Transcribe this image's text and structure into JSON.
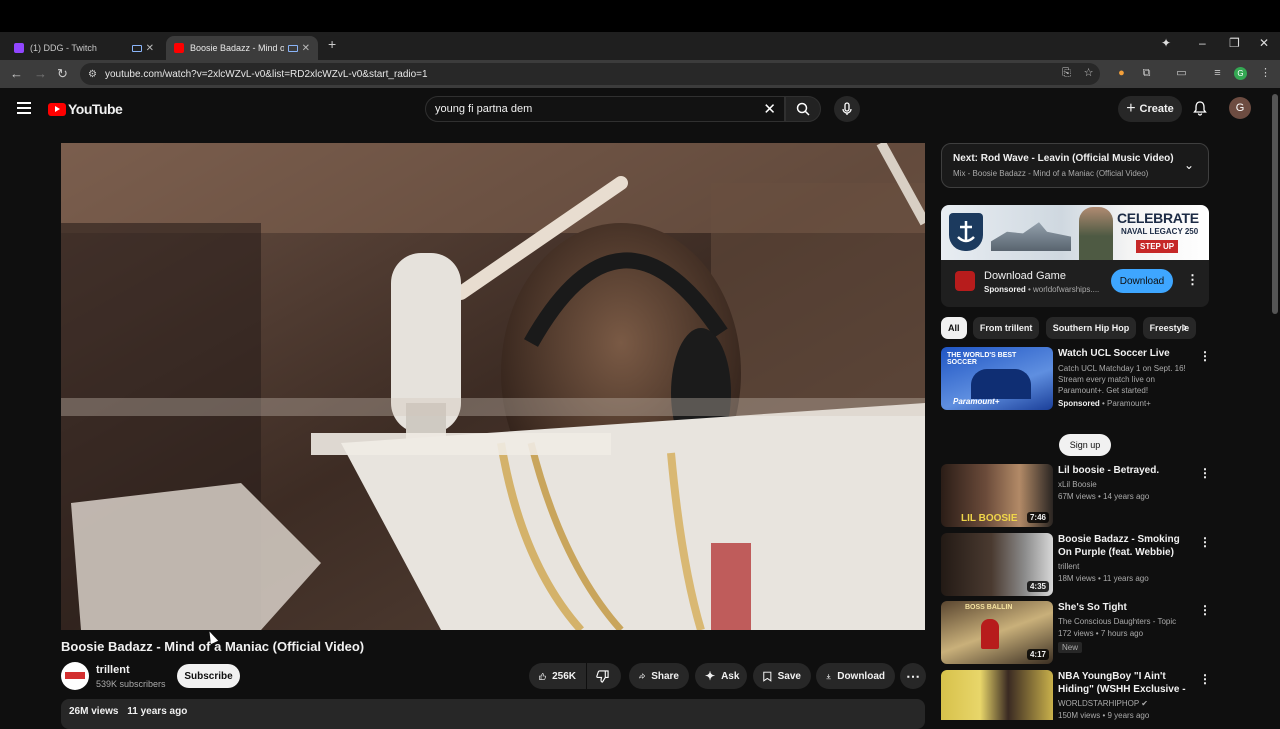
{
  "browser": {
    "tabs": [
      {
        "title": "(1) DDG - Twitch",
        "favicon_color": "#9146ff"
      },
      {
        "title": "Boosie Badazz - Mind of a Maniac (Official Video)",
        "favicon_color": "#ff0000"
      }
    ],
    "url": "youtube.com/watch?v=2xlcWZvL-v0&list=RD2xlcWZvL-v0&start_radio=1"
  },
  "masthead": {
    "logo_text": "YouTube",
    "search_value": "young fi partna dem",
    "create_label": "Create",
    "avatar_letter": "G"
  },
  "video": {
    "title": "Boosie Badazz - Mind of a Maniac (Official Video)",
    "channel": "trillent",
    "subscribers": "539K subscribers",
    "subscribe_label": "Subscribe",
    "likes": "256K",
    "share_label": "Share",
    "ask_label": "Ask",
    "save_label": "Save",
    "download_label": "Download",
    "views": "26M views",
    "age": "11 years ago"
  },
  "up_next": {
    "prefix": "Next:",
    "title": "Rod Wave - Leavin (Official Music Video)",
    "mix": "Mix - Boosie Badazz - Mind of a Maniac (Official Video)"
  },
  "ad": {
    "banner_headline": "CELEBRATE",
    "banner_sub": "NAVAL LEGACY 250",
    "banner_cta": "STEP UP",
    "title": "Download Game",
    "sponsored": "Sponsored",
    "advertiser": "worldofwarships....",
    "button": "Download"
  },
  "chips": [
    "All",
    "From trillent",
    "Southern Hip Hop",
    "Freestyle"
  ],
  "recommendations": [
    {
      "title": "Watch UCL Soccer Live",
      "desc": "Catch UCL Matchday 1 on Sept. 16! Stream every match live on Paramount+. Get started!",
      "sponsored": "Sponsored",
      "advertiser": "Paramount+",
      "button": "Sign up",
      "thumb_caption": "THE WORLD'S BEST SOCCER",
      "thumb_brand": "Paramount+"
    },
    {
      "title": "Lil boosie - Betrayed.",
      "channel": "xLil Boosie",
      "meta": "67M views • 14 years ago",
      "duration": "7:46",
      "thumb_caption": "LIL BOOSIE"
    },
    {
      "title": "Boosie Badazz - Smoking On Purple (feat. Webbie) [Official ...",
      "channel": "trillent",
      "meta": "18M views • 11 years ago",
      "duration": "4:35"
    },
    {
      "title": "She's So Tight",
      "channel": "The Conscious Daughters - Topic",
      "meta": "172 views • 7 hours ago",
      "duration": "4:17",
      "badge": "New",
      "thumb_caption": "BOSS BALLIN"
    },
    {
      "title": "NBA YoungBoy \"I Ain't Hiding\" (WSHH Exclusive - Official ...",
      "channel": "WORLDSTARHIPHOP",
      "meta": "150M views • 9 years ago"
    }
  ]
}
